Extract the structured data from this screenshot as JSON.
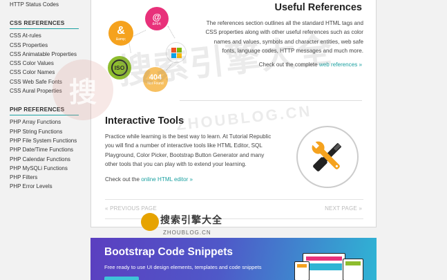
{
  "sidebar": {
    "top_link": "HTTP Status Codes",
    "css_heading": "CSS REFERENCES",
    "css_items": [
      "CSS At-rules",
      "CSS Properties",
      "CSS Animatable Properties",
      "CSS Color Values",
      "CSS Color Names",
      "CSS Web Safe Fonts",
      "CSS Aural Properties"
    ],
    "php_heading": "PHP REFERENCES",
    "php_items": [
      "PHP Array Functions",
      "PHP String Functions",
      "PHP File System Functions",
      "PHP Date/Time Functions",
      "PHP Calendar Functions",
      "PHP MySQLi Functions",
      "PHP Filters",
      "PHP Error Levels"
    ]
  },
  "illustration": {
    "amp": "&",
    "amp_label": "&amp;",
    "at": "@",
    "at_label": "&#64;",
    "iso": "ISO",
    "num": "404",
    "num_label": "Not Found",
    "icons": [
      "ampersand-badge-icon",
      "at-badge-icon",
      "windows-logo-icon",
      "iso-badge-icon",
      "404-badge-icon"
    ],
    "colors": {
      "amp": "#f5a21e",
      "at": "#e8317a",
      "iso": "#8ebd2e",
      "num": "#f7c061"
    }
  },
  "useful": {
    "title": "Useful References",
    "description": "The references section outlines all the standard HTML tags and CSS properties along with other useful references such as color names and values, symbols and character entities, web safe fonts, language codes, HTTP messages and much more.",
    "link_prefix": "Check out the complete ",
    "link_text": "web references »"
  },
  "interactive": {
    "title": "Interactive Tools",
    "description": "Practice while learning is the best way to learn. At Tutorial Republic you will find a number of interactive tools like HTML Editor, SQL Playground, Color Picker, Bootstrap Button Generator and many other tools that you can play with to extend your learning.",
    "link_prefix": "Check out the ",
    "link_text": "online HTML editor »",
    "icon": "wrench-screwdriver-icon"
  },
  "pager": {
    "prev_label": "« PREVIOUS PAGE",
    "next_label": "NEXT PAGE »"
  },
  "banner": {
    "title": "Bootstrap Code Snippets",
    "subtitle": "Free ready to use UI design elements, templates and code snippets"
  },
  "watermark": {
    "cn": "搜索引擎大全",
    "en": "ZHOUBLOG.CN",
    "seal": "搜",
    "small_cn": "搜索引擎大全",
    "small_en": "ZHOUBLOG.CN"
  },
  "theme": {
    "accent": "#1aa0a0"
  }
}
